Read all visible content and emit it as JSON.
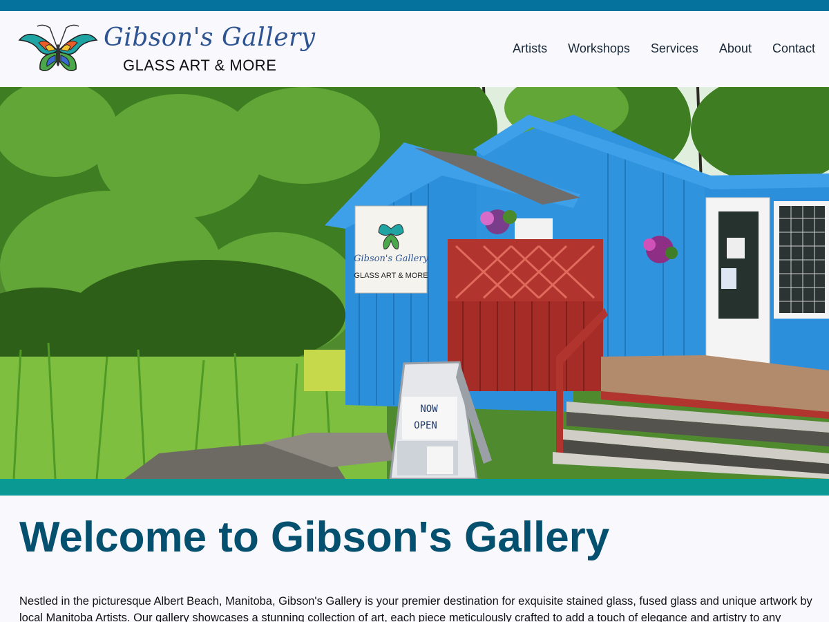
{
  "brand": {
    "title": "Gibson's Gallery",
    "subtitle": "GLASS ART & MORE"
  },
  "nav": {
    "items": [
      "Artists",
      "Workshops",
      "Services",
      "About",
      "Contact"
    ]
  },
  "hero": {
    "sign_title": "Gibson's Gallery",
    "sign_subtitle": "GLASS ART & MORE",
    "board_line1": "NOW",
    "board_line2": "OPEN"
  },
  "main": {
    "heading": "Welcome to Gibson's Gallery",
    "intro": "Nestled in the picturesque Albert Beach, Manitoba, Gibson's Gallery is your premier destination for exquisite stained glass, fused glass and unique artwork by local Manitoba Artists. Our gallery showcases a stunning collection of art, each piece meticulously crafted to add a touch of elegance and artistry to any space."
  },
  "colors": {
    "top_strip": "#04729c",
    "accent_strip": "#0a9a93",
    "heading": "#05506e",
    "brand_script": "#2d5390",
    "building": "#2b8fdb",
    "deck": "#b2342e"
  },
  "icons": {
    "logo": "butterfly-icon"
  }
}
